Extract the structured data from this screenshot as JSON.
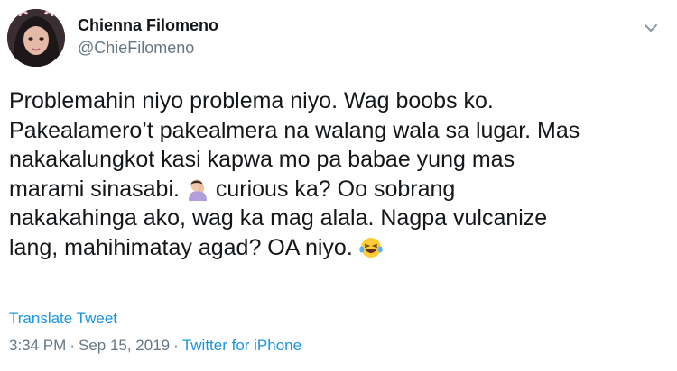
{
  "author": {
    "name": "Chienna Filomeno",
    "handle": "@ChieFilomeno"
  },
  "tweet": {
    "lines": [
      "Problemahin niyo problema niyo. Wag boobs ko.",
      "Pakealamero’t pakealmera na walang wala sa lugar. Mas",
      "nakakalungkot kasi kapwa mo pa babae yung mas",
      "marami sinasabi.",
      "curious ka? Oo sobrang",
      "nakakahinga ako, wag ka mag alala. Nagpa vulcanize",
      "lang, mahihimatay agad? OA niyo."
    ],
    "emojis": [
      "facepalm-woman-emoji",
      "laughing-tears-emoji"
    ]
  },
  "translate_label": "Translate Tweet",
  "meta": {
    "time": "3:34 PM",
    "separator": "·",
    "date": "Sep 15, 2019",
    "source": "Twitter for iPhone"
  },
  "icons": {
    "caret": "chevron-down-icon"
  },
  "colors": {
    "link": "#1b95e0",
    "secondary": "#657786",
    "text": "#14171a"
  }
}
